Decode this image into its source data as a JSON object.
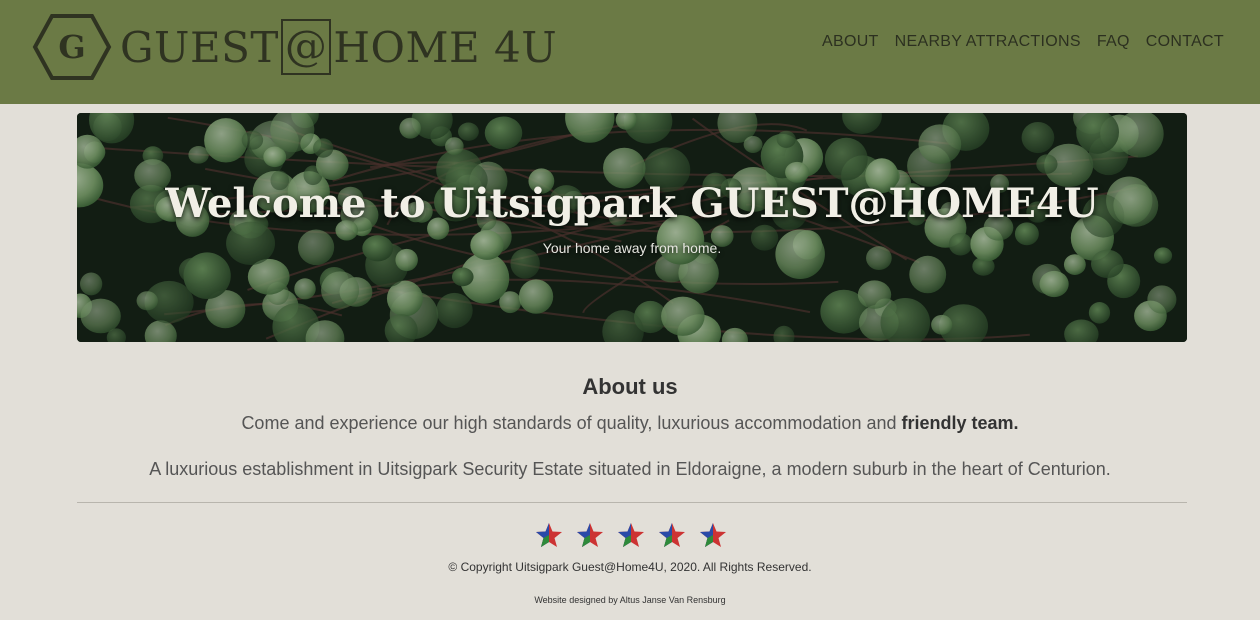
{
  "header": {
    "logo_letter": "G",
    "logo_text_before": "GUEST",
    "logo_text_at": "@",
    "logo_text_after": "HOME 4U",
    "nav": [
      {
        "label": "ABOUT"
      },
      {
        "label": "NEARBY ATTRACTIONS"
      },
      {
        "label": "FAQ"
      },
      {
        "label": "CONTACT"
      }
    ],
    "bg_color": "#6b7a45"
  },
  "hero": {
    "title": "Welcome to Uitsigpark GUEST@HOME4U",
    "subtitle": "Your home away from home."
  },
  "about": {
    "heading": "About us",
    "p1_text": "Come and experience our high standards of quality, luxurious accommodation and",
    "p1_bold": "friendly team.",
    "p2": "A luxurious establishment in Uitsigpark Security Estate situated in Eldoraigne, a modern suburb in the heart of Centurion."
  },
  "footer": {
    "rating": 5,
    "rating_max": 5,
    "copyright": "© Copyright Uitsigpark Guest@Home4U, 2020. All Rights Reserved.",
    "credit": "Website designed by Altus Janse Van Rensburg"
  }
}
